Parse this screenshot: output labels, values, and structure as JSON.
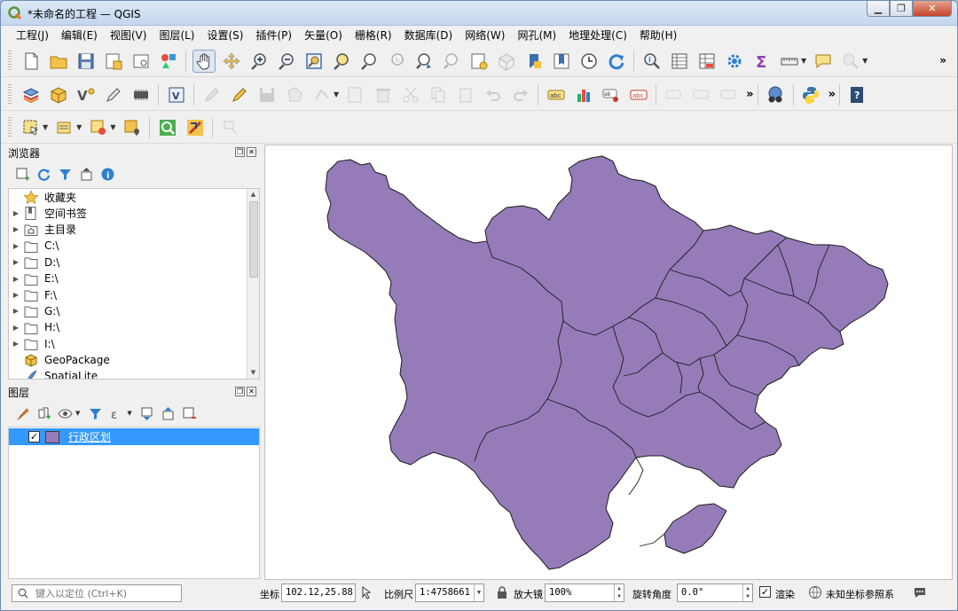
{
  "window": {
    "title": "*未命名的工程 — QGIS"
  },
  "menu": [
    "工程(J)",
    "编辑(E)",
    "视图(V)",
    "图层(L)",
    "设置(S)",
    "插件(P)",
    "矢量(O)",
    "栅格(R)",
    "数据库(D)",
    "网络(W)",
    "网孔(M)",
    "地理处理(C)",
    "帮助(H)"
  ],
  "browser": {
    "title": "浏览器",
    "items": [
      {
        "label": "收藏夹",
        "icon": "star-icon",
        "expandable": false
      },
      {
        "label": "空间书签",
        "icon": "bookmark-icon",
        "expandable": true
      },
      {
        "label": "主目录",
        "icon": "home-folder-icon",
        "expandable": true
      },
      {
        "label": "C:\\",
        "icon": "folder-icon",
        "expandable": true
      },
      {
        "label": "D:\\",
        "icon": "folder-icon",
        "expandable": true
      },
      {
        "label": "E:\\",
        "icon": "folder-icon",
        "expandable": true
      },
      {
        "label": "F:\\",
        "icon": "folder-icon",
        "expandable": true
      },
      {
        "label": "G:\\",
        "icon": "folder-icon",
        "expandable": true
      },
      {
        "label": "H:\\",
        "icon": "folder-icon",
        "expandable": true
      },
      {
        "label": "I:\\",
        "icon": "folder-icon",
        "expandable": true
      },
      {
        "label": "GeoPackage",
        "icon": "geopackage-icon",
        "expandable": false
      },
      {
        "label": "SpatiaLite",
        "icon": "spatialite-icon",
        "expandable": false
      }
    ]
  },
  "layers": {
    "title": "图层",
    "items": [
      {
        "label": "行政区划",
        "checked": true,
        "color": "#957cb9"
      }
    ]
  },
  "map": {
    "fill_color": "#957cb9",
    "stroke_color": "#1a1a1a"
  },
  "status": {
    "locator_placeholder": "键入以定位 (Ctrl+K)",
    "coord_label": "坐标",
    "coord_value": "102.12,25.88",
    "scale_label": "比例尺",
    "scale_value": "1:4758661",
    "magnifier_label": "放大镜",
    "magnifier_value": "100%",
    "rotation_label": "旋转角度",
    "rotation_value": "0.0°",
    "render_label": "渲染",
    "crs_label": "未知坐标参照系"
  }
}
